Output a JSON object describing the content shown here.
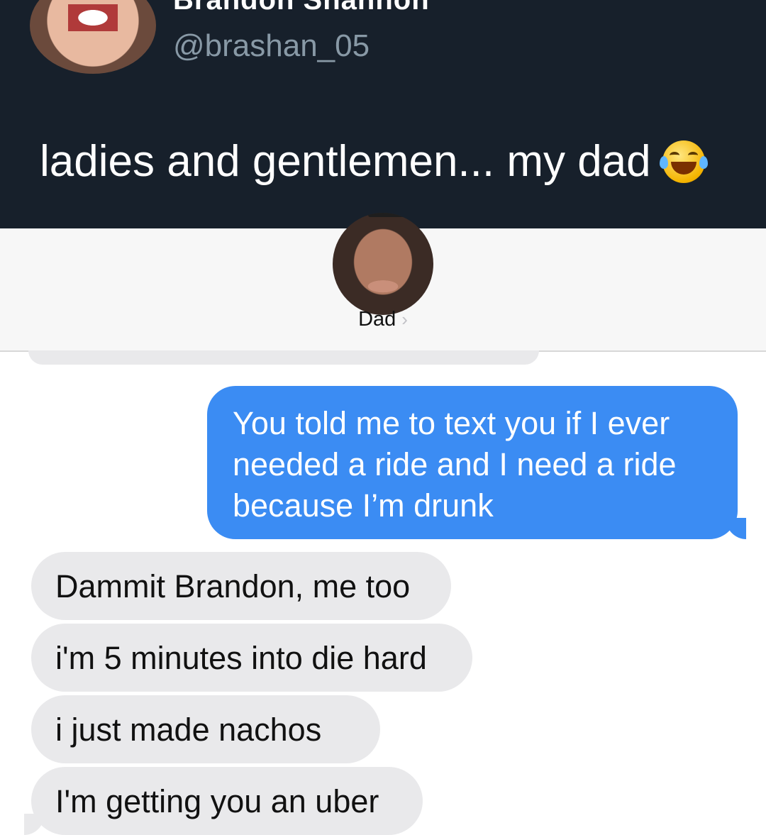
{
  "tweet": {
    "display_name": "Brandon Shannon",
    "handle": "@brashan_05",
    "text": "ladies and gentlemen... my dad",
    "emoji": "face-with-tears-of-joy"
  },
  "conversation": {
    "contact_name": "Dad",
    "contact_chevron": "›",
    "messages": [
      {
        "direction": "outgoing",
        "text": "You told me to text you if I ever needed a ride and I need a ride because I’m drunk"
      },
      {
        "direction": "incoming",
        "text": "Dammit Brandon, me too"
      },
      {
        "direction": "incoming",
        "text": "i'm 5 minutes into die hard"
      },
      {
        "direction": "incoming",
        "text": "i just made nachos"
      },
      {
        "direction": "incoming",
        "text": "I'm getting you an uber"
      }
    ]
  },
  "colors": {
    "tweet_background": "#17202b",
    "outgoing_bubble": "#3b8cf3",
    "incoming_bubble": "#e9e9eb",
    "handle_text": "#8899a6"
  }
}
